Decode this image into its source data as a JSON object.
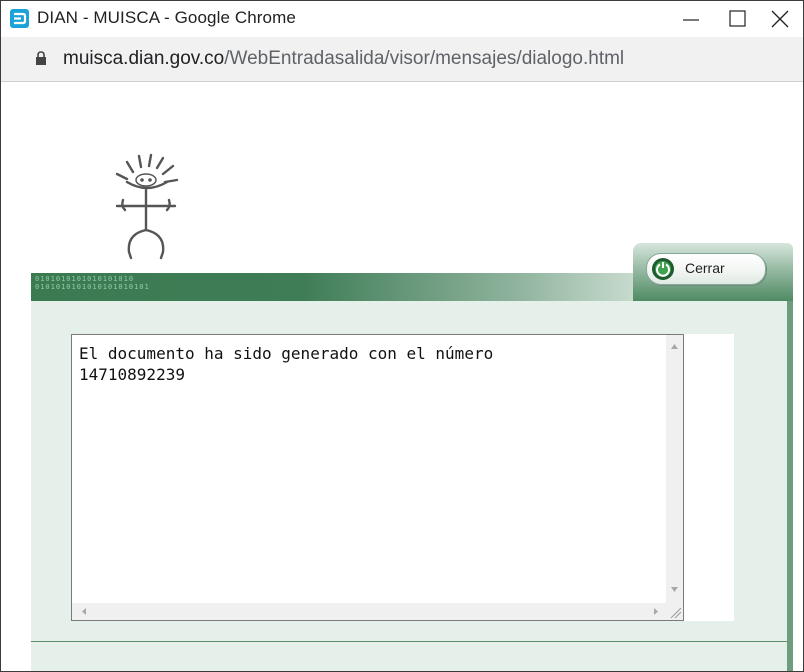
{
  "window": {
    "title": "DIAN - MUISCA - Google Chrome",
    "controls": {
      "minimize": "minimize-icon",
      "maximize": "maximize-icon",
      "close": "close-icon"
    }
  },
  "addressbar": {
    "url_host": "muisca.dian.gov.co",
    "url_path": "/WebEntradasalida/visor/mensajes/dialogo.html"
  },
  "dialog": {
    "band_digits_line1": "0101010101010101010",
    "band_digits_line2": "0101010101010101010101",
    "close_button_label": "Cerrar",
    "message_line1": "El documento ha sido generado con el número",
    "message_line2": "14710892239"
  },
  "colors": {
    "brand_green": "#3c7a52",
    "panel_bg": "#e5f0ea"
  }
}
